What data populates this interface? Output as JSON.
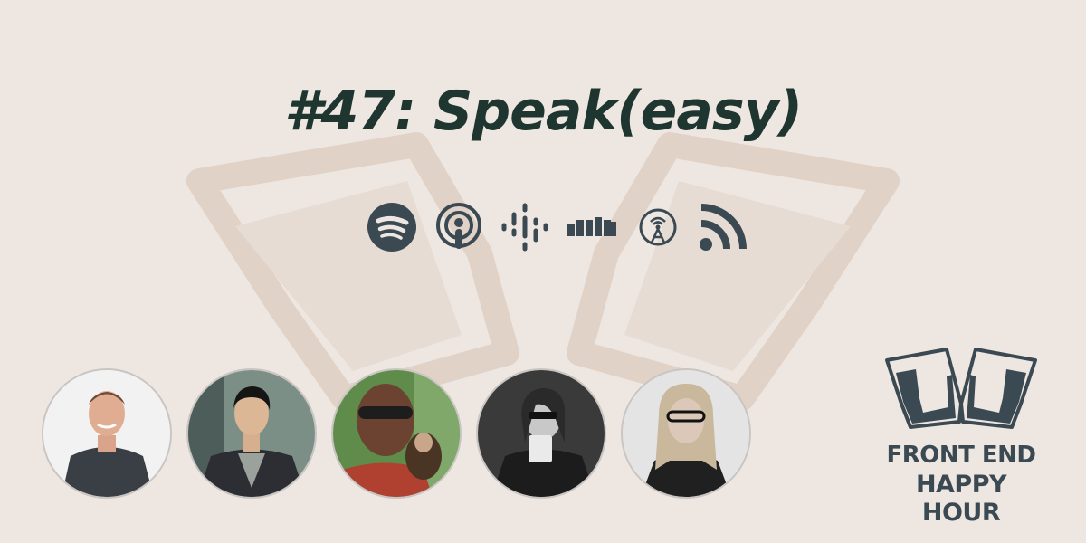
{
  "episode": {
    "title": "#47: Speak(easy)"
  },
  "platforms": [
    {
      "name": "spotify",
      "icon": "spotify-icon"
    },
    {
      "name": "apple-podcasts",
      "icon": "apple-podcasts-icon"
    },
    {
      "name": "google-podcasts",
      "icon": "google-podcasts-icon"
    },
    {
      "name": "castbox",
      "icon": "castbox-icon"
    },
    {
      "name": "overcast",
      "icon": "overcast-icon"
    },
    {
      "name": "rss",
      "icon": "rss-icon"
    }
  ],
  "hosts": [
    {
      "photo": "host-photo-1"
    },
    {
      "photo": "host-photo-2"
    },
    {
      "photo": "host-photo-3"
    },
    {
      "photo": "host-photo-4"
    },
    {
      "photo": "host-photo-5"
    }
  ],
  "brand": {
    "line1": "FRONT END",
    "line2": "HAPPY HOUR"
  },
  "colors": {
    "background": "#ede6e1",
    "title": "#1f3530",
    "icons": "#3b4a52",
    "watermark": "#dfd3c8"
  }
}
